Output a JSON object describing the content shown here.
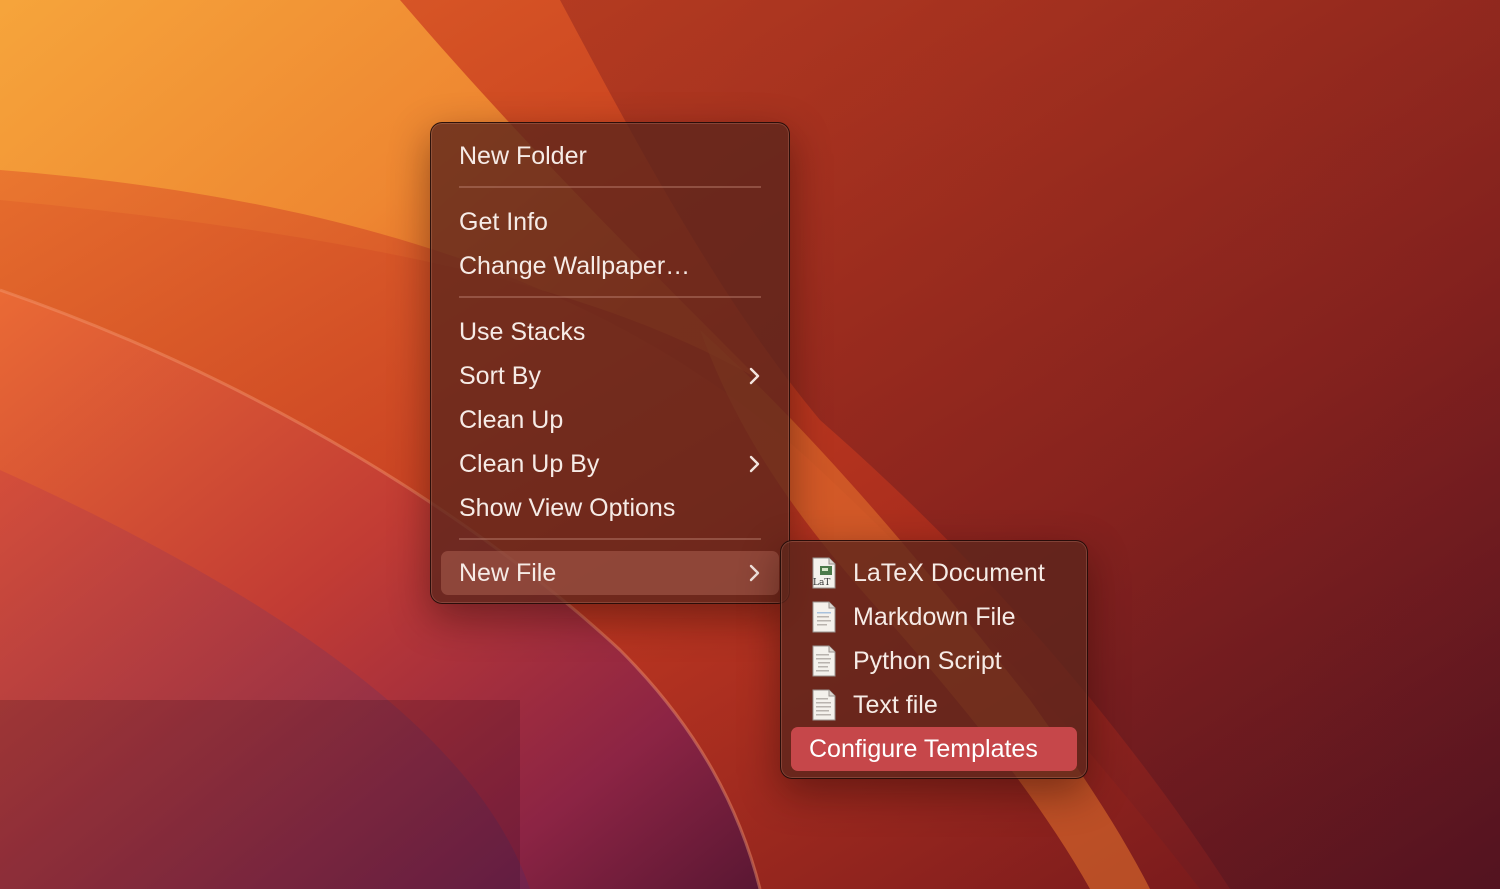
{
  "wallpaper": {
    "name": "macOS Ventura wallpaper",
    "colors": [
      "#f7a23a",
      "#e05a27",
      "#b8331f",
      "#8a1f1f",
      "#5a1423",
      "#6b2348"
    ]
  },
  "context_menu": {
    "items": [
      {
        "label": "New Folder"
      },
      {
        "label": "Get Info"
      },
      {
        "label": "Change Wallpaper…"
      },
      {
        "label": "Use Stacks"
      },
      {
        "label": "Sort By",
        "submenu_icon": "chevron-right-icon"
      },
      {
        "label": "Clean Up"
      },
      {
        "label": "Clean Up By",
        "submenu_icon": "chevron-right-icon"
      },
      {
        "label": "Show View Options"
      },
      {
        "label": "New File",
        "submenu_icon": "chevron-right-icon",
        "highlighted": true
      }
    ]
  },
  "submenu": {
    "items": [
      {
        "label": "LaTeX Document",
        "icon": "latex-document-icon"
      },
      {
        "label": "Markdown File",
        "icon": "markdown-file-icon"
      },
      {
        "label": "Python Script",
        "icon": "python-script-icon"
      },
      {
        "label": "Text file",
        "icon": "text-file-icon"
      },
      {
        "label": "Configure Templates",
        "selected": true
      }
    ],
    "highlight_color": "#c6474a"
  }
}
